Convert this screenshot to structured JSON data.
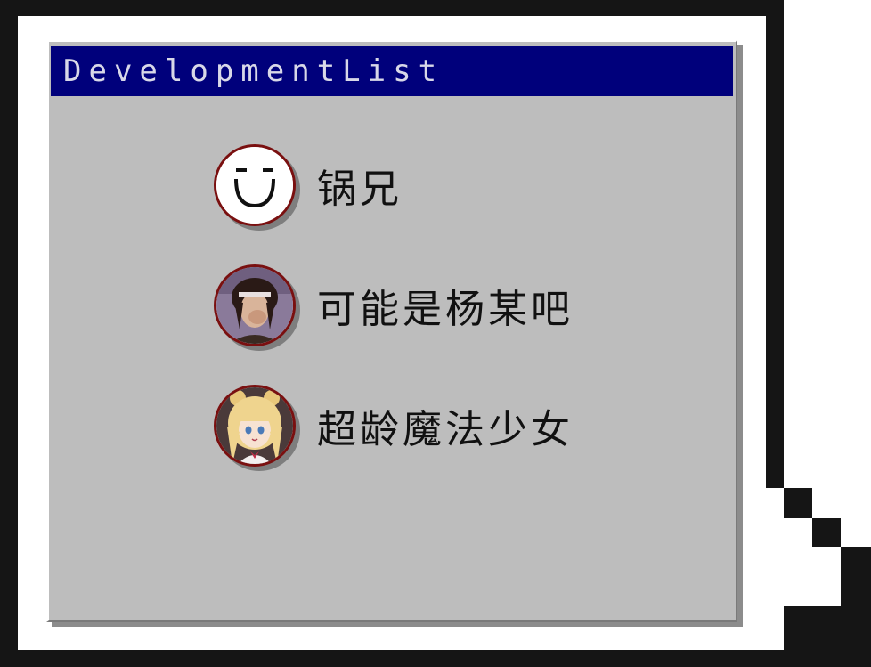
{
  "window": {
    "title": "DevelopmentList"
  },
  "developers": [
    {
      "name": "锅兄",
      "avatar": "smiley-face-icon"
    },
    {
      "name": "可能是杨某吧",
      "avatar": "dark-haired-man-avatar"
    },
    {
      "name": "超龄魔法少女",
      "avatar": "blonde-anime-girl-avatar"
    }
  ],
  "colors": {
    "titlebar": "#00007b",
    "window_bg": "#bdbdbd",
    "frame": "#151515",
    "avatar_border": "#7a1010"
  }
}
